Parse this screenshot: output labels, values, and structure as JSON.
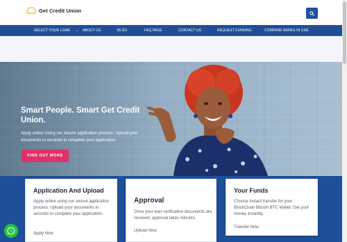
{
  "brand": {
    "name": "Get Credit Union"
  },
  "nav": {
    "items": [
      {
        "label": "SELECT YOUR LOAN",
        "has_caret": true
      },
      {
        "label": "ABOUT US"
      },
      {
        "label": "BLOG"
      },
      {
        "label": "FAQ PAGE"
      },
      {
        "label": "CONTACT US"
      },
      {
        "label": "REQUEST FUNDING"
      },
      {
        "label": "COMPARE BANKS IN USA"
      }
    ]
  },
  "hero": {
    "title": "Smart People. Smart Get Credit Union.",
    "text": "Apply online Using our secure application process. Upload your documents in seconds to complete your application.",
    "button": "FIND OUT MORE"
  },
  "cards": [
    {
      "title": "Application And Upload",
      "text": "Apply online using our secure application process. Upload your documents in seconds to complete your application.",
      "link": "Apply Now"
    },
    {
      "title": "Approval",
      "text": "Once your loan verification documents are received, approval takes minutes.",
      "link": "Upload Now"
    },
    {
      "title": "Your Funds",
      "text": "Choose instant transfer for your BlockChain Bitcoin BTC Wallet; Get your money instantly.",
      "link": "Transfer Now"
    }
  ],
  "icons": {
    "logo": "house-logo-icon",
    "search": "search-icon",
    "caret": "chevron-down-icon",
    "chat": "whatsapp-icon"
  },
  "colors": {
    "nav": "#1f4f99",
    "accent": "#e0316b",
    "logo": "#f3b724",
    "whatsapp": "#25c33f"
  }
}
